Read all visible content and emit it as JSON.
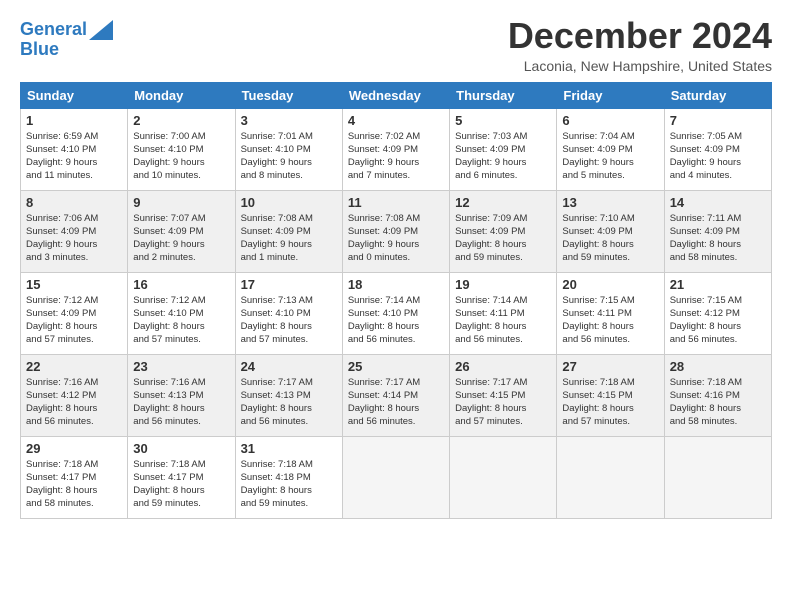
{
  "header": {
    "logo_line1": "General",
    "logo_line2": "Blue",
    "month_title": "December 2024",
    "location": "Laconia, New Hampshire, United States"
  },
  "weekdays": [
    "Sunday",
    "Monday",
    "Tuesday",
    "Wednesday",
    "Thursday",
    "Friday",
    "Saturday"
  ],
  "weeks": [
    [
      {
        "day": "1",
        "info": "Sunrise: 6:59 AM\nSunset: 4:10 PM\nDaylight: 9 hours\nand 11 minutes."
      },
      {
        "day": "2",
        "info": "Sunrise: 7:00 AM\nSunset: 4:10 PM\nDaylight: 9 hours\nand 10 minutes."
      },
      {
        "day": "3",
        "info": "Sunrise: 7:01 AM\nSunset: 4:10 PM\nDaylight: 9 hours\nand 8 minutes."
      },
      {
        "day": "4",
        "info": "Sunrise: 7:02 AM\nSunset: 4:09 PM\nDaylight: 9 hours\nand 7 minutes."
      },
      {
        "day": "5",
        "info": "Sunrise: 7:03 AM\nSunset: 4:09 PM\nDaylight: 9 hours\nand 6 minutes."
      },
      {
        "day": "6",
        "info": "Sunrise: 7:04 AM\nSunset: 4:09 PM\nDaylight: 9 hours\nand 5 minutes."
      },
      {
        "day": "7",
        "info": "Sunrise: 7:05 AM\nSunset: 4:09 PM\nDaylight: 9 hours\nand 4 minutes."
      }
    ],
    [
      {
        "day": "8",
        "info": "Sunrise: 7:06 AM\nSunset: 4:09 PM\nDaylight: 9 hours\nand 3 minutes."
      },
      {
        "day": "9",
        "info": "Sunrise: 7:07 AM\nSunset: 4:09 PM\nDaylight: 9 hours\nand 2 minutes."
      },
      {
        "day": "10",
        "info": "Sunrise: 7:08 AM\nSunset: 4:09 PM\nDaylight: 9 hours\nand 1 minute."
      },
      {
        "day": "11",
        "info": "Sunrise: 7:08 AM\nSunset: 4:09 PM\nDaylight: 9 hours\nand 0 minutes."
      },
      {
        "day": "12",
        "info": "Sunrise: 7:09 AM\nSunset: 4:09 PM\nDaylight: 8 hours\nand 59 minutes."
      },
      {
        "day": "13",
        "info": "Sunrise: 7:10 AM\nSunset: 4:09 PM\nDaylight: 8 hours\nand 59 minutes."
      },
      {
        "day": "14",
        "info": "Sunrise: 7:11 AM\nSunset: 4:09 PM\nDaylight: 8 hours\nand 58 minutes."
      }
    ],
    [
      {
        "day": "15",
        "info": "Sunrise: 7:12 AM\nSunset: 4:09 PM\nDaylight: 8 hours\nand 57 minutes."
      },
      {
        "day": "16",
        "info": "Sunrise: 7:12 AM\nSunset: 4:10 PM\nDaylight: 8 hours\nand 57 minutes."
      },
      {
        "day": "17",
        "info": "Sunrise: 7:13 AM\nSunset: 4:10 PM\nDaylight: 8 hours\nand 57 minutes."
      },
      {
        "day": "18",
        "info": "Sunrise: 7:14 AM\nSunset: 4:10 PM\nDaylight: 8 hours\nand 56 minutes."
      },
      {
        "day": "19",
        "info": "Sunrise: 7:14 AM\nSunset: 4:11 PM\nDaylight: 8 hours\nand 56 minutes."
      },
      {
        "day": "20",
        "info": "Sunrise: 7:15 AM\nSunset: 4:11 PM\nDaylight: 8 hours\nand 56 minutes."
      },
      {
        "day": "21",
        "info": "Sunrise: 7:15 AM\nSunset: 4:12 PM\nDaylight: 8 hours\nand 56 minutes."
      }
    ],
    [
      {
        "day": "22",
        "info": "Sunrise: 7:16 AM\nSunset: 4:12 PM\nDaylight: 8 hours\nand 56 minutes."
      },
      {
        "day": "23",
        "info": "Sunrise: 7:16 AM\nSunset: 4:13 PM\nDaylight: 8 hours\nand 56 minutes."
      },
      {
        "day": "24",
        "info": "Sunrise: 7:17 AM\nSunset: 4:13 PM\nDaylight: 8 hours\nand 56 minutes."
      },
      {
        "day": "25",
        "info": "Sunrise: 7:17 AM\nSunset: 4:14 PM\nDaylight: 8 hours\nand 56 minutes."
      },
      {
        "day": "26",
        "info": "Sunrise: 7:17 AM\nSunset: 4:15 PM\nDaylight: 8 hours\nand 57 minutes."
      },
      {
        "day": "27",
        "info": "Sunrise: 7:18 AM\nSunset: 4:15 PM\nDaylight: 8 hours\nand 57 minutes."
      },
      {
        "day": "28",
        "info": "Sunrise: 7:18 AM\nSunset: 4:16 PM\nDaylight: 8 hours\nand 58 minutes."
      }
    ],
    [
      {
        "day": "29",
        "info": "Sunrise: 7:18 AM\nSunset: 4:17 PM\nDaylight: 8 hours\nand 58 minutes."
      },
      {
        "day": "30",
        "info": "Sunrise: 7:18 AM\nSunset: 4:17 PM\nDaylight: 8 hours\nand 59 minutes."
      },
      {
        "day": "31",
        "info": "Sunrise: 7:18 AM\nSunset: 4:18 PM\nDaylight: 8 hours\nand 59 minutes."
      },
      null,
      null,
      null,
      null
    ]
  ]
}
